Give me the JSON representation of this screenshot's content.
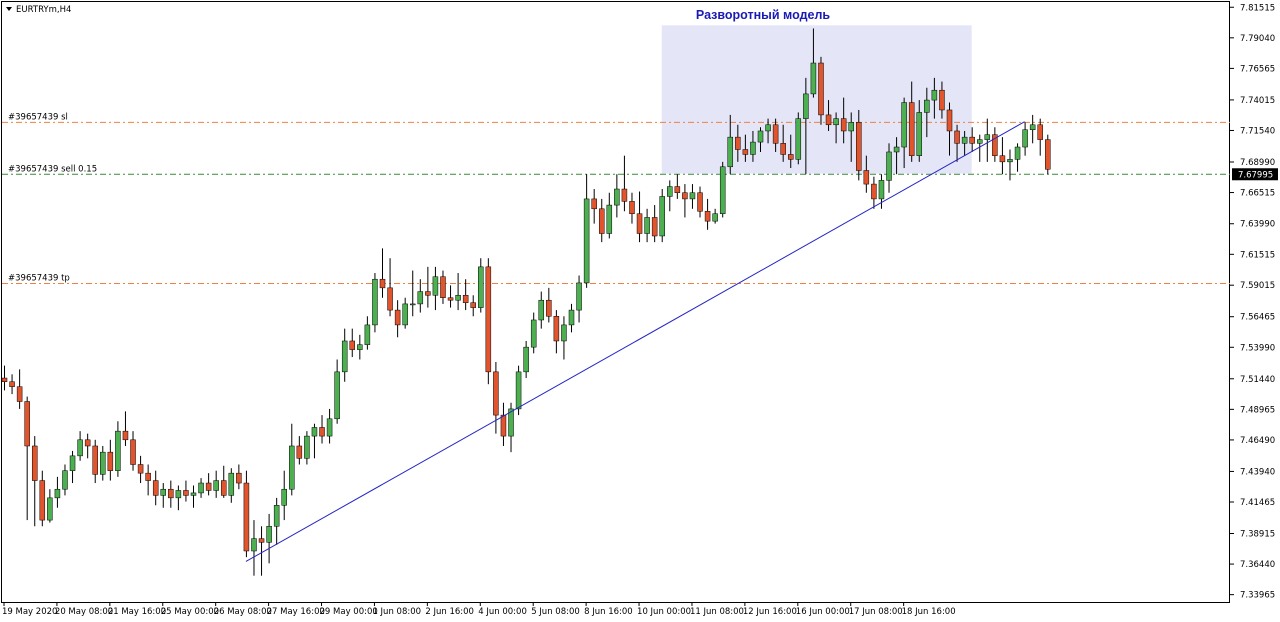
{
  "window": {
    "title": "EURTRYm,H4",
    "menu_icon": "triangle-down-icon"
  },
  "colors": {
    "bull": "#4caf50",
    "bear": "#e0552d",
    "wick": "#000000",
    "highlight": "#e4e6f8",
    "trendline": "#2424c8",
    "level_orange": "#f08040",
    "level_green": "#3a8a3a",
    "title": "#1a1ab4",
    "price_tag_bg": "#000000",
    "price_tag_fg": "#ffffff"
  },
  "chart_data": {
    "type": "candlestick",
    "title": "Разворотный модель",
    "ylim": [
      7.3337,
      7.8194
    ],
    "y_ticks": [
      "7.81515",
      "7.79040",
      "7.76565",
      "7.74015",
      "7.71540",
      "7.68990",
      "7.66515",
      "7.63990",
      "7.61515",
      "7.59015",
      "7.56465",
      "7.53990",
      "7.51440",
      "7.48965",
      "7.46490",
      "7.43940",
      "7.41465",
      "7.38915",
      "7.36440",
      "7.33965"
    ],
    "x_ticks": [
      {
        "i": 0,
        "label": "19 May 2020"
      },
      {
        "i": 7,
        "label": "20 May 08:00"
      },
      {
        "i": 14,
        "label": "21 May 16:00"
      },
      {
        "i": 21,
        "label": "25 May 00:00"
      },
      {
        "i": 28,
        "label": "26 May 08:00"
      },
      {
        "i": 35,
        "label": "27 May 16:00"
      },
      {
        "i": 42,
        "label": "29 May 00:00"
      },
      {
        "i": 49,
        "label": "1 Jun 08:00"
      },
      {
        "i": 56,
        "label": "2 Jun 16:00"
      },
      {
        "i": 63,
        "label": "4 Jun 00:00"
      },
      {
        "i": 70,
        "label": "5 Jun 08:00"
      },
      {
        "i": 77,
        "label": "8 Jun 16:00"
      },
      {
        "i": 84,
        "label": "10 Jun 00:00"
      },
      {
        "i": 91,
        "label": "11 Jun 08:00"
      },
      {
        "i": 98,
        "label": "12 Jun 16:00"
      },
      {
        "i": 105,
        "label": "16 Jun 00:00"
      },
      {
        "i": 112,
        "label": "17 Jun 08:00"
      },
      {
        "i": 119,
        "label": "18 Jun 16:00"
      }
    ],
    "candles": [
      [
        7.515,
        7.525,
        7.505,
        7.512
      ],
      [
        7.512,
        7.518,
        7.502,
        7.508
      ],
      [
        7.508,
        7.522,
        7.49,
        7.496
      ],
      [
        7.496,
        7.5,
        7.4,
        7.46
      ],
      [
        7.46,
        7.468,
        7.395,
        7.432
      ],
      [
        7.432,
        7.44,
        7.395,
        7.4
      ],
      [
        7.4,
        7.425,
        7.398,
        7.418
      ],
      [
        7.418,
        7.435,
        7.41,
        7.425
      ],
      [
        7.425,
        7.445,
        7.42,
        7.44
      ],
      [
        7.44,
        7.456,
        7.43,
        7.452
      ],
      [
        7.452,
        7.472,
        7.448,
        7.465
      ],
      [
        7.465,
        7.47,
        7.45,
        7.46
      ],
      [
        7.46,
        7.465,
        7.43,
        7.437
      ],
      [
        7.437,
        7.46,
        7.432,
        7.455
      ],
      [
        7.455,
        7.465,
        7.432,
        7.44
      ],
      [
        7.44,
        7.48,
        7.435,
        7.472
      ],
      [
        7.472,
        7.488,
        7.46,
        7.465
      ],
      [
        7.465,
        7.472,
        7.44,
        7.445
      ],
      [
        7.445,
        7.452,
        7.43,
        7.438
      ],
      [
        7.438,
        7.445,
        7.42,
        7.432
      ],
      [
        7.432,
        7.44,
        7.412,
        7.42
      ],
      [
        7.42,
        7.43,
        7.41,
        7.425
      ],
      [
        7.425,
        7.432,
        7.41,
        7.418
      ],
      [
        7.418,
        7.428,
        7.408,
        7.424
      ],
      [
        7.424,
        7.432,
        7.415,
        7.42
      ],
      [
        7.42,
        7.428,
        7.41,
        7.422
      ],
      [
        7.422,
        7.434,
        7.418,
        7.43
      ],
      [
        7.43,
        7.438,
        7.42,
        7.424
      ],
      [
        7.424,
        7.44,
        7.418,
        7.432
      ],
      [
        7.432,
        7.444,
        7.418,
        7.42
      ],
      [
        7.42,
        7.442,
        7.414,
        7.438
      ],
      [
        7.438,
        7.445,
        7.425,
        7.43
      ],
      [
        7.43,
        7.44,
        7.37,
        7.375
      ],
      [
        7.375,
        7.4,
        7.355,
        7.385
      ],
      [
        7.385,
        7.395,
        7.355,
        7.382
      ],
      [
        7.382,
        7.405,
        7.365,
        7.395
      ],
      [
        7.395,
        7.418,
        7.38,
        7.412
      ],
      [
        7.412,
        7.44,
        7.4,
        7.425
      ],
      [
        7.425,
        7.478,
        7.42,
        7.46
      ],
      [
        7.46,
        7.468,
        7.445,
        7.45
      ],
      [
        7.45,
        7.472,
        7.445,
        7.468
      ],
      [
        7.468,
        7.478,
        7.45,
        7.475
      ],
      [
        7.475,
        7.485,
        7.462,
        7.468
      ],
      [
        7.468,
        7.49,
        7.462,
        7.482
      ],
      [
        7.482,
        7.53,
        7.478,
        7.52
      ],
      [
        7.52,
        7.555,
        7.512,
        7.545
      ],
      [
        7.545,
        7.555,
        7.532,
        7.538
      ],
      [
        7.538,
        7.55,
        7.53,
        7.542
      ],
      [
        7.542,
        7.565,
        7.538,
        7.558
      ],
      [
        7.558,
        7.6,
        7.552,
        7.595
      ],
      [
        7.595,
        7.62,
        7.58,
        7.588
      ],
      [
        7.588,
        7.612,
        7.565,
        7.57
      ],
      [
        7.57,
        7.578,
        7.548,
        7.558
      ],
      [
        7.558,
        7.58,
        7.555,
        7.575
      ],
      [
        7.575,
        7.602,
        7.565,
        7.575
      ],
      [
        7.575,
        7.595,
        7.568,
        7.585
      ],
      [
        7.585,
        7.605,
        7.572,
        7.582
      ],
      [
        7.582,
        7.605,
        7.57,
        7.597
      ],
      [
        7.597,
        7.602,
        7.575,
        7.58
      ],
      [
        7.58,
        7.59,
        7.572,
        7.578
      ],
      [
        7.578,
        7.6,
        7.57,
        7.582
      ],
      [
        7.582,
        7.595,
        7.57,
        7.576
      ],
      [
        7.576,
        7.582,
        7.565,
        7.572
      ],
      [
        7.572,
        7.612,
        7.568,
        7.605
      ],
      [
        7.605,
        7.612,
        7.51,
        7.52
      ],
      [
        7.52,
        7.528,
        7.47,
        7.485
      ],
      [
        7.485,
        7.495,
        7.46,
        7.468
      ],
      [
        7.468,
        7.495,
        7.455,
        7.49
      ],
      [
        7.49,
        7.525,
        7.485,
        7.52
      ],
      [
        7.52,
        7.545,
        7.515,
        7.54
      ],
      [
        7.54,
        7.568,
        7.535,
        7.562
      ],
      [
        7.562,
        7.585,
        7.555,
        7.578
      ],
      [
        7.578,
        7.588,
        7.56,
        7.565
      ],
      [
        7.565,
        7.57,
        7.535,
        7.545
      ],
      [
        7.545,
        7.565,
        7.53,
        7.558
      ],
      [
        7.558,
        7.575,
        7.552,
        7.57
      ],
      [
        7.57,
        7.598,
        7.56,
        7.592
      ],
      [
        7.592,
        7.68,
        7.588,
        7.66
      ],
      [
        7.66,
        7.668,
        7.64,
        7.652
      ],
      [
        7.652,
        7.66,
        7.625,
        7.632
      ],
      [
        7.632,
        7.665,
        7.628,
        7.655
      ],
      [
        7.655,
        7.68,
        7.645,
        7.668
      ],
      [
        7.668,
        7.695,
        7.65,
        7.658
      ],
      [
        7.658,
        7.665,
        7.64,
        7.648
      ],
      [
        7.648,
        7.666,
        7.625,
        7.632
      ],
      [
        7.632,
        7.652,
        7.625,
        7.645
      ],
      [
        7.645,
        7.655,
        7.625,
        7.63
      ],
      [
        7.63,
        7.668,
        7.625,
        7.662
      ],
      [
        7.662,
        7.675,
        7.65,
        7.67
      ],
      [
        7.67,
        7.68,
        7.66,
        7.665
      ],
      [
        7.665,
        7.672,
        7.645,
        7.66
      ],
      [
        7.66,
        7.672,
        7.652,
        7.665
      ],
      [
        7.665,
        7.67,
        7.645,
        7.65
      ],
      [
        7.65,
        7.66,
        7.635,
        7.642
      ],
      [
        7.642,
        7.652,
        7.64,
        7.648
      ],
      [
        7.648,
        7.69,
        7.645,
        7.686
      ],
      [
        7.686,
        7.728,
        7.68,
        7.71
      ],
      [
        7.71,
        7.72,
        7.69,
        7.7
      ],
      [
        7.7,
        7.712,
        7.69,
        7.696
      ],
      [
        7.696,
        7.715,
        7.69,
        7.706
      ],
      [
        7.706,
        7.718,
        7.698,
        7.715
      ],
      [
        7.715,
        7.725,
        7.705,
        7.72
      ],
      [
        7.72,
        7.725,
        7.698,
        7.705
      ],
      [
        7.705,
        7.72,
        7.69,
        7.696
      ],
      [
        7.696,
        7.712,
        7.685,
        7.692
      ],
      [
        7.692,
        7.73,
        7.688,
        7.725
      ],
      [
        7.725,
        7.758,
        7.68,
        7.745
      ],
      [
        7.745,
        7.798,
        7.742,
        7.77
      ],
      [
        7.77,
        7.775,
        7.72,
        7.728
      ],
      [
        7.728,
        7.74,
        7.715,
        7.72
      ],
      [
        7.72,
        7.73,
        7.705,
        7.725
      ],
      [
        7.725,
        7.742,
        7.705,
        7.715
      ],
      [
        7.715,
        7.73,
        7.69,
        7.722
      ],
      [
        7.722,
        7.732,
        7.675,
        7.683
      ],
      [
        7.683,
        7.695,
        7.665,
        7.672
      ],
      [
        7.672,
        7.678,
        7.652,
        7.66
      ],
      [
        7.66,
        7.68,
        7.652,
        7.675
      ],
      [
        7.675,
        7.705,
        7.665,
        7.698
      ],
      [
        7.698,
        7.71,
        7.68,
        7.702
      ],
      [
        7.702,
        7.742,
        7.685,
        7.738
      ],
      [
        7.738,
        7.755,
        7.69,
        7.695
      ],
      [
        7.695,
        7.74,
        7.69,
        7.73
      ],
      [
        7.73,
        7.75,
        7.71,
        7.74
      ],
      [
        7.74,
        7.758,
        7.725,
        7.748
      ],
      [
        7.748,
        7.755,
        7.725,
        7.732
      ],
      [
        7.732,
        7.738,
        7.695,
        7.715
      ],
      [
        7.715,
        7.72,
        7.69,
        7.705
      ],
      [
        7.705,
        7.715,
        7.695,
        7.71
      ],
      [
        7.71,
        7.718,
        7.698,
        7.705
      ],
      [
        7.705,
        7.712,
        7.69,
        7.708
      ],
      [
        7.708,
        7.725,
        7.69,
        7.712
      ],
      [
        7.712,
        7.718,
        7.69,
        7.695
      ],
      [
        7.695,
        7.71,
        7.68,
        7.69
      ],
      [
        7.69,
        7.7,
        7.675,
        7.692
      ],
      [
        7.692,
        7.705,
        7.682,
        7.702
      ],
      [
        7.702,
        7.722,
        7.695,
        7.716
      ],
      [
        7.716,
        7.728,
        7.705,
        7.72
      ],
      [
        7.72,
        7.725,
        7.695,
        7.708
      ],
      [
        7.708,
        7.712,
        7.68,
        7.684
      ]
    ],
    "levels": [
      {
        "label": "#39657439 sl",
        "value": 7.722,
        "color": "#f08040"
      },
      {
        "label": "#39657439 sell 0.15",
        "value": 7.67995,
        "color": "#3a8a3a"
      },
      {
        "label": "#39657439 tp",
        "value": 7.5915,
        "color": "#f08040"
      }
    ],
    "current_price": "7.67995",
    "trendline": {
      "from_index": 32,
      "from_value": 7.3665,
      "to_index": 135,
      "to_value": 7.7225
    },
    "highlight_zone": {
      "from_index": 87,
      "to_index": 128,
      "from_value": 7.6805,
      "to_value": 7.8005
    }
  }
}
